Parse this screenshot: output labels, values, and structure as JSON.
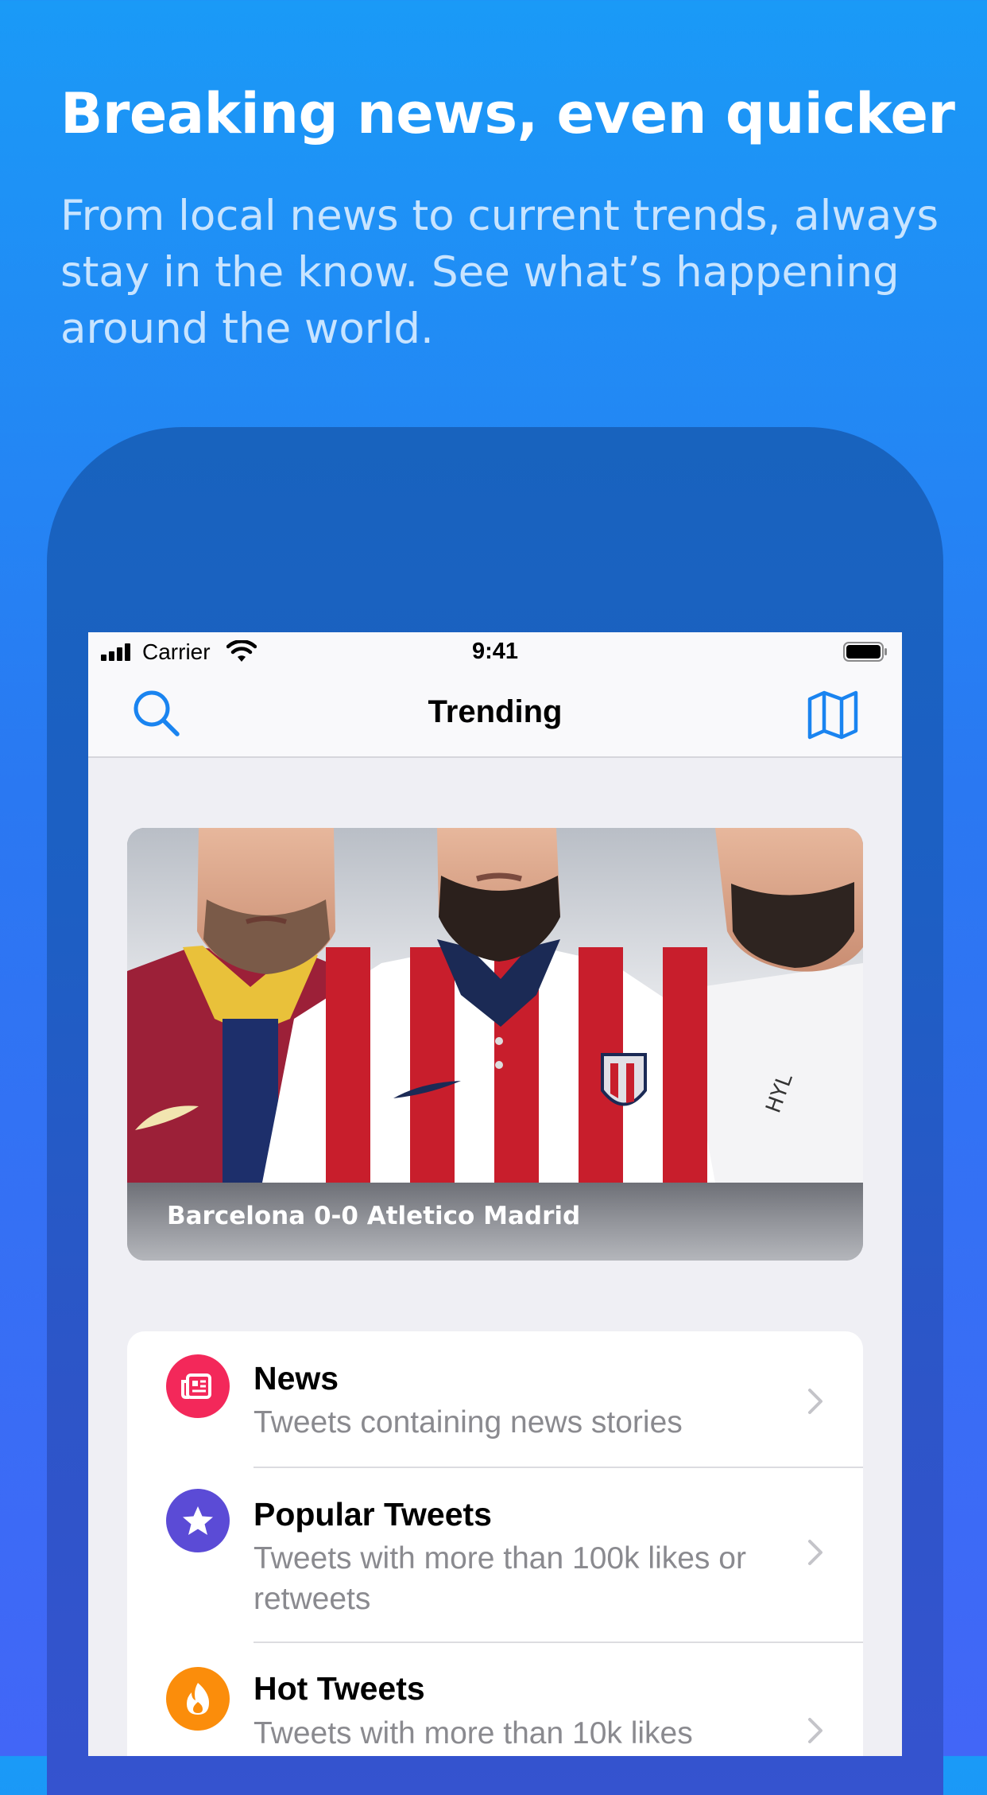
{
  "promo": {
    "headline": "Breaking news, even quicker",
    "subhead": "From local news to current trends, always stay in the know. See what’s happening around the world."
  },
  "status_bar": {
    "carrier": "Carrier",
    "time": "9:41"
  },
  "nav": {
    "title": "Trending",
    "left_icon": "search-icon",
    "right_icon": "map-icon"
  },
  "hero": {
    "caption": "Barcelona 0-0 Atletico Madrid"
  },
  "categories": [
    {
      "title": "News",
      "subtitle": "Tweets containing news stories",
      "icon": "newspaper-icon",
      "color": "#f3285a"
    },
    {
      "title": "Popular Tweets",
      "subtitle": "Tweets with more than 100k likes or retweets",
      "icon": "star-icon",
      "color": "#5b4bd6"
    },
    {
      "title": "Hot Tweets",
      "subtitle": "Tweets with more than 10k likes",
      "icon": "flame-icon",
      "color": "#fb8d0b"
    }
  ],
  "colors": {
    "accent": "#1a84f0",
    "background_top": "#1a9af7",
    "background_bottom": "#4266f7"
  }
}
